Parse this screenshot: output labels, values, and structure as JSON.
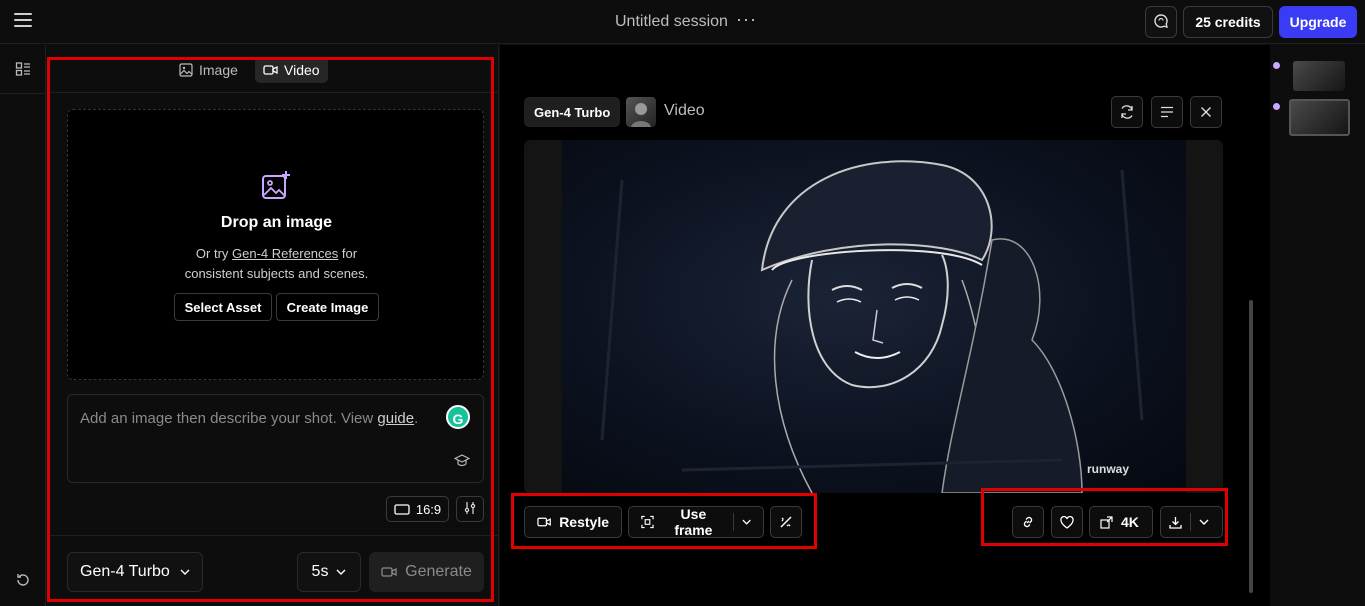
{
  "topbar": {
    "session_title": "Untitled session",
    "more_label": "···",
    "credits_label": "25 credits",
    "upgrade_label": "Upgrade"
  },
  "left_panel": {
    "tabs": [
      {
        "label": "Image",
        "icon": "image-icon"
      },
      {
        "label": "Video",
        "icon": "video-camera-icon"
      }
    ],
    "dropzone": {
      "title": "Drop an image",
      "sub_prefix": "Or try ",
      "sub_link": "Gen-4 References",
      "sub_suffix": " for",
      "sub_line2": "consistent subjects and scenes.",
      "select_asset_label": "Select Asset",
      "create_image_label": "Create Image"
    },
    "prompt": {
      "placeholder_prefix": "Add an image then describe your shot. View ",
      "placeholder_link": "guide",
      "placeholder_suffix": ".",
      "grammarly_label": "G"
    },
    "aspect_ratio": "16:9",
    "model_label": "Gen-4 Turbo",
    "duration_label": "5s",
    "generate_label": "Generate"
  },
  "main": {
    "model_chip": "Gen-4 Turbo",
    "media_type": "Video",
    "watermark": "runway",
    "actions": {
      "restyle_label": "Restyle",
      "use_frame_label": "Use frame",
      "upscale_label": "4K"
    }
  },
  "colors": {
    "accent": "#3a3bf5",
    "highlight_box": "#e00000",
    "history_dot": "#c9a8ff"
  }
}
